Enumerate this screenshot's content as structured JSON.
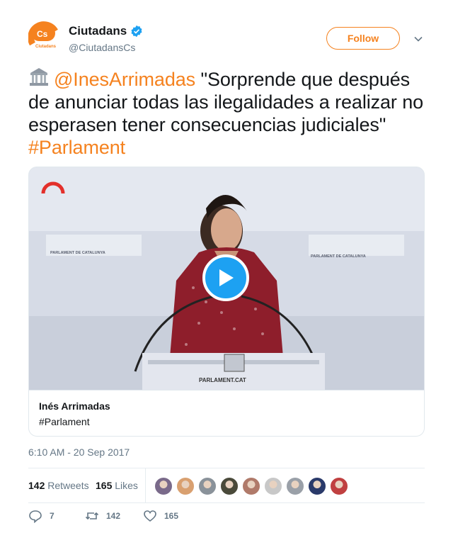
{
  "account": {
    "display_name": "Ciutadans",
    "handle": "@CiutadansCs",
    "avatar_text": "Cs",
    "avatar_subtext": "Ciutadans",
    "brand_color": "#f5821f",
    "verified_color": "#1da1f2"
  },
  "header": {
    "follow_label": "Follow",
    "menu_icon": "chevron-down-icon"
  },
  "tweet": {
    "emoji_icon": "classical-building-icon",
    "mention": "@InesArrimadas",
    "text": " \"Sorprende que después de anunciar todas las ilegalidades a realizar no esperasen tener consecuencias judiciales\" ",
    "hashtag": "#Parlament"
  },
  "card": {
    "play_icon": "play-icon",
    "backdrop_label": "PARLAMENT DE CATALUNYA",
    "podium_label": "PARLAMENT.CAT",
    "title": "Inés Arrimadas",
    "description": "#Parlament"
  },
  "timestamp": "6:10 AM - 20 Sep 2017",
  "stats": {
    "retweets_count": "142",
    "retweets_label": "Retweets",
    "likes_count": "165",
    "likes_label": "Likes",
    "face_colors": [
      "#7a6a8a",
      "#d9a070",
      "#8a929a",
      "#4a4a3a",
      "#b07a6a",
      "#c8c8c8",
      "#9aa0a8",
      "#2a3a6a",
      "#c04040"
    ]
  },
  "actions": {
    "reply_count": "7",
    "retweet_count": "142",
    "like_count": "165"
  }
}
